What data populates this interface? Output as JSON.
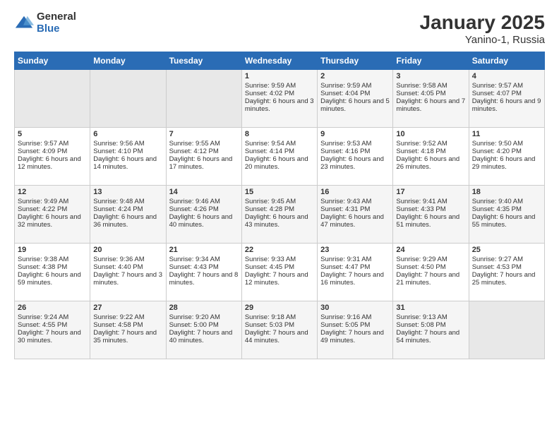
{
  "header": {
    "logo_general": "General",
    "logo_blue": "Blue",
    "title": "January 2025",
    "subtitle": "Yanino-1, Russia"
  },
  "days_header": [
    "Sunday",
    "Monday",
    "Tuesday",
    "Wednesday",
    "Thursday",
    "Friday",
    "Saturday"
  ],
  "weeks": [
    [
      {
        "day": "",
        "sunrise": "",
        "sunset": "",
        "daylight": ""
      },
      {
        "day": "",
        "sunrise": "",
        "sunset": "",
        "daylight": ""
      },
      {
        "day": "",
        "sunrise": "",
        "sunset": "",
        "daylight": ""
      },
      {
        "day": "1",
        "sunrise": "Sunrise: 9:59 AM",
        "sunset": "Sunset: 4:02 PM",
        "daylight": "Daylight: 6 hours and 3 minutes."
      },
      {
        "day": "2",
        "sunrise": "Sunrise: 9:59 AM",
        "sunset": "Sunset: 4:04 PM",
        "daylight": "Daylight: 6 hours and 5 minutes."
      },
      {
        "day": "3",
        "sunrise": "Sunrise: 9:58 AM",
        "sunset": "Sunset: 4:05 PM",
        "daylight": "Daylight: 6 hours and 7 minutes."
      },
      {
        "day": "4",
        "sunrise": "Sunrise: 9:57 AM",
        "sunset": "Sunset: 4:07 PM",
        "daylight": "Daylight: 6 hours and 9 minutes."
      }
    ],
    [
      {
        "day": "5",
        "sunrise": "Sunrise: 9:57 AM",
        "sunset": "Sunset: 4:09 PM",
        "daylight": "Daylight: 6 hours and 12 minutes."
      },
      {
        "day": "6",
        "sunrise": "Sunrise: 9:56 AM",
        "sunset": "Sunset: 4:10 PM",
        "daylight": "Daylight: 6 hours and 14 minutes."
      },
      {
        "day": "7",
        "sunrise": "Sunrise: 9:55 AM",
        "sunset": "Sunset: 4:12 PM",
        "daylight": "Daylight: 6 hours and 17 minutes."
      },
      {
        "day": "8",
        "sunrise": "Sunrise: 9:54 AM",
        "sunset": "Sunset: 4:14 PM",
        "daylight": "Daylight: 6 hours and 20 minutes."
      },
      {
        "day": "9",
        "sunrise": "Sunrise: 9:53 AM",
        "sunset": "Sunset: 4:16 PM",
        "daylight": "Daylight: 6 hours and 23 minutes."
      },
      {
        "day": "10",
        "sunrise": "Sunrise: 9:52 AM",
        "sunset": "Sunset: 4:18 PM",
        "daylight": "Daylight: 6 hours and 26 minutes."
      },
      {
        "day": "11",
        "sunrise": "Sunrise: 9:50 AM",
        "sunset": "Sunset: 4:20 PM",
        "daylight": "Daylight: 6 hours and 29 minutes."
      }
    ],
    [
      {
        "day": "12",
        "sunrise": "Sunrise: 9:49 AM",
        "sunset": "Sunset: 4:22 PM",
        "daylight": "Daylight: 6 hours and 32 minutes."
      },
      {
        "day": "13",
        "sunrise": "Sunrise: 9:48 AM",
        "sunset": "Sunset: 4:24 PM",
        "daylight": "Daylight: 6 hours and 36 minutes."
      },
      {
        "day": "14",
        "sunrise": "Sunrise: 9:46 AM",
        "sunset": "Sunset: 4:26 PM",
        "daylight": "Daylight: 6 hours and 40 minutes."
      },
      {
        "day": "15",
        "sunrise": "Sunrise: 9:45 AM",
        "sunset": "Sunset: 4:28 PM",
        "daylight": "Daylight: 6 hours and 43 minutes."
      },
      {
        "day": "16",
        "sunrise": "Sunrise: 9:43 AM",
        "sunset": "Sunset: 4:31 PM",
        "daylight": "Daylight: 6 hours and 47 minutes."
      },
      {
        "day": "17",
        "sunrise": "Sunrise: 9:41 AM",
        "sunset": "Sunset: 4:33 PM",
        "daylight": "Daylight: 6 hours and 51 minutes."
      },
      {
        "day": "18",
        "sunrise": "Sunrise: 9:40 AM",
        "sunset": "Sunset: 4:35 PM",
        "daylight": "Daylight: 6 hours and 55 minutes."
      }
    ],
    [
      {
        "day": "19",
        "sunrise": "Sunrise: 9:38 AM",
        "sunset": "Sunset: 4:38 PM",
        "daylight": "Daylight: 6 hours and 59 minutes."
      },
      {
        "day": "20",
        "sunrise": "Sunrise: 9:36 AM",
        "sunset": "Sunset: 4:40 PM",
        "daylight": "Daylight: 7 hours and 3 minutes."
      },
      {
        "day": "21",
        "sunrise": "Sunrise: 9:34 AM",
        "sunset": "Sunset: 4:43 PM",
        "daylight": "Daylight: 7 hours and 8 minutes."
      },
      {
        "day": "22",
        "sunrise": "Sunrise: 9:33 AM",
        "sunset": "Sunset: 4:45 PM",
        "daylight": "Daylight: 7 hours and 12 minutes."
      },
      {
        "day": "23",
        "sunrise": "Sunrise: 9:31 AM",
        "sunset": "Sunset: 4:47 PM",
        "daylight": "Daylight: 7 hours and 16 minutes."
      },
      {
        "day": "24",
        "sunrise": "Sunrise: 9:29 AM",
        "sunset": "Sunset: 4:50 PM",
        "daylight": "Daylight: 7 hours and 21 minutes."
      },
      {
        "day": "25",
        "sunrise": "Sunrise: 9:27 AM",
        "sunset": "Sunset: 4:53 PM",
        "daylight": "Daylight: 7 hours and 25 minutes."
      }
    ],
    [
      {
        "day": "26",
        "sunrise": "Sunrise: 9:24 AM",
        "sunset": "Sunset: 4:55 PM",
        "daylight": "Daylight: 7 hours and 30 minutes."
      },
      {
        "day": "27",
        "sunrise": "Sunrise: 9:22 AM",
        "sunset": "Sunset: 4:58 PM",
        "daylight": "Daylight: 7 hours and 35 minutes."
      },
      {
        "day": "28",
        "sunrise": "Sunrise: 9:20 AM",
        "sunset": "Sunset: 5:00 PM",
        "daylight": "Daylight: 7 hours and 40 minutes."
      },
      {
        "day": "29",
        "sunrise": "Sunrise: 9:18 AM",
        "sunset": "Sunset: 5:03 PM",
        "daylight": "Daylight: 7 hours and 44 minutes."
      },
      {
        "day": "30",
        "sunrise": "Sunrise: 9:16 AM",
        "sunset": "Sunset: 5:05 PM",
        "daylight": "Daylight: 7 hours and 49 minutes."
      },
      {
        "day": "31",
        "sunrise": "Sunrise: 9:13 AM",
        "sunset": "Sunset: 5:08 PM",
        "daylight": "Daylight: 7 hours and 54 minutes."
      },
      {
        "day": "",
        "sunrise": "",
        "sunset": "",
        "daylight": ""
      }
    ]
  ]
}
